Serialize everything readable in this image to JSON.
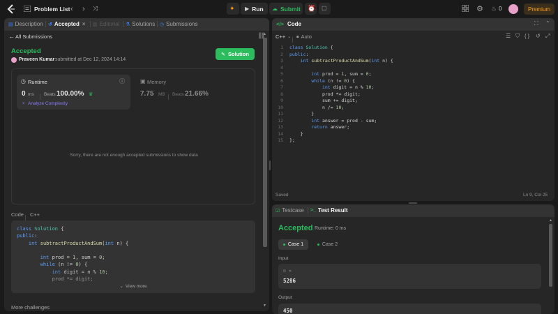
{
  "topbar": {
    "problem_list": "Problem List",
    "run": "Run",
    "submit": "Submit",
    "streak": "0",
    "premium": "Premium"
  },
  "left_tabs": {
    "description": "Description",
    "accepted": "Accepted",
    "editorial": "Editorial",
    "solutions": "Solutions",
    "submissions": "Submissions"
  },
  "submission": {
    "back_label": "All Submissions",
    "status": "Accepted",
    "user": "Praveen Kumar",
    "submitted_text": "submitted at Dec 12, 2024 14:14",
    "solution_button": "Solution",
    "runtime": {
      "label": "Runtime",
      "value": "0",
      "unit": "ms",
      "beats_label": "Beats",
      "beats_value": "100.00%",
      "analyze": "Analyze Complexity"
    },
    "memory": {
      "label": "Memory",
      "value": "7.75",
      "unit": "MB",
      "beats_label": "Beats",
      "beats_value": "21.66%"
    },
    "empty_message": "Sorry, there are not enough accepted submissions to show data",
    "code_label": "Code",
    "code_lang": "C++",
    "view_more": "View more",
    "more_challenges": "More challenges"
  },
  "left_code_lines": [
    "class Solution {",
    "public:",
    "    int subtractProductAndSum(int n) {",
    "",
    "        int prod = 1, sum = 0;",
    "        while (n != 0) {",
    "            int digit = n % 10;",
    "            prod *= digit;"
  ],
  "editor": {
    "title": "Code",
    "language": "C++",
    "mode": "Auto",
    "status_left": "Saved",
    "status_right": "Ln 9, Col 25",
    "line_numbers": [
      "1",
      "2",
      "3",
      "4",
      "5",
      "6",
      "7",
      "8",
      "9",
      "10",
      "11",
      "12",
      "13",
      "14",
      "15"
    ],
    "lines": [
      "class Solution {",
      "public:",
      "    int subtractProductAndSum(int n) {",
      "",
      "        int prod = 1, sum = 0;",
      "        while (n != 0) {",
      "            int digit = n % 10;",
      "            prod *= digit;",
      "            sum += digit;",
      "            n /= 10;",
      "        }",
      "        int answer = prod - sum;",
      "        return answer;",
      "    }",
      "};"
    ]
  },
  "result": {
    "tab_testcase": "Testcase",
    "tab_result": "Test Result",
    "status": "Accepted",
    "runtime": "Runtime: 0 ms",
    "case1": "Case 1",
    "case2": "Case 2",
    "input_label": "Input",
    "input_var": "n =",
    "input_value": "5286",
    "output_label": "Output",
    "output_value": "450"
  },
  "colors": {
    "accent_green": "#2cbb5d",
    "premium_orange": "#ffa116",
    "link_blue": "#3b82f6"
  }
}
